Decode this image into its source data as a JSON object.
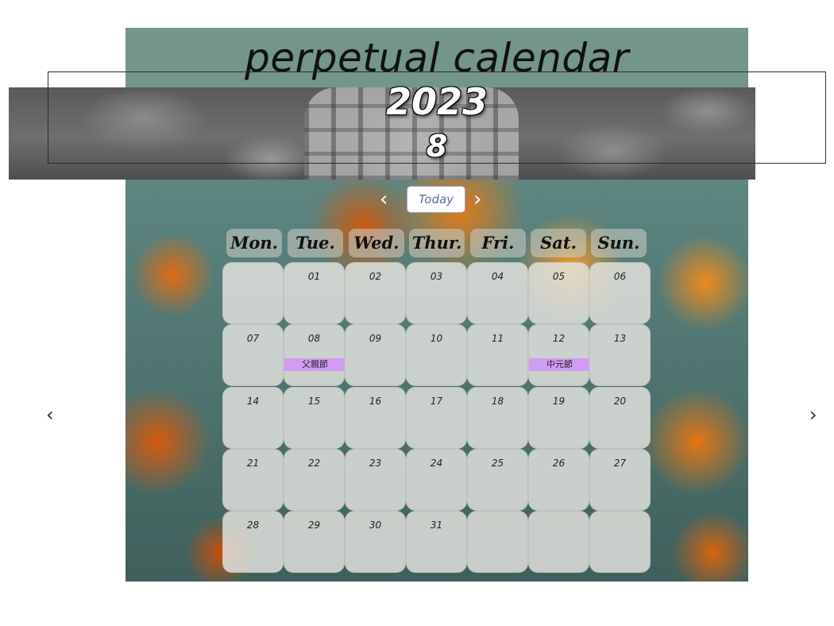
{
  "header": {
    "title": "perpetual calendar",
    "year": "2023",
    "month": "8"
  },
  "nav": {
    "prev": "‹",
    "today_label": "Today",
    "next": "›"
  },
  "side_nav": {
    "prev": "‹",
    "next": "›"
  },
  "weekdays": [
    "Mon.",
    "Tue.",
    "Wed.",
    "Thur.",
    "Fri.",
    "Sat.",
    "Sun."
  ],
  "weeks": [
    [
      "",
      "01",
      "02",
      "03",
      "04",
      "05",
      "06"
    ],
    [
      "07",
      "08",
      "09",
      "10",
      "11",
      "12",
      "13"
    ],
    [
      "14",
      "15",
      "16",
      "17",
      "18",
      "19",
      "20"
    ],
    [
      "21",
      "22",
      "23",
      "24",
      "25",
      "26",
      "27"
    ],
    [
      "28",
      "29",
      "30",
      "31",
      "",
      "",
      ""
    ]
  ],
  "events": {
    "aug8": "父親節",
    "aug12": "中元節"
  },
  "colors": {
    "title_band": "#74958c",
    "event": "#d29cf5",
    "today_text": "#5b6d96"
  }
}
